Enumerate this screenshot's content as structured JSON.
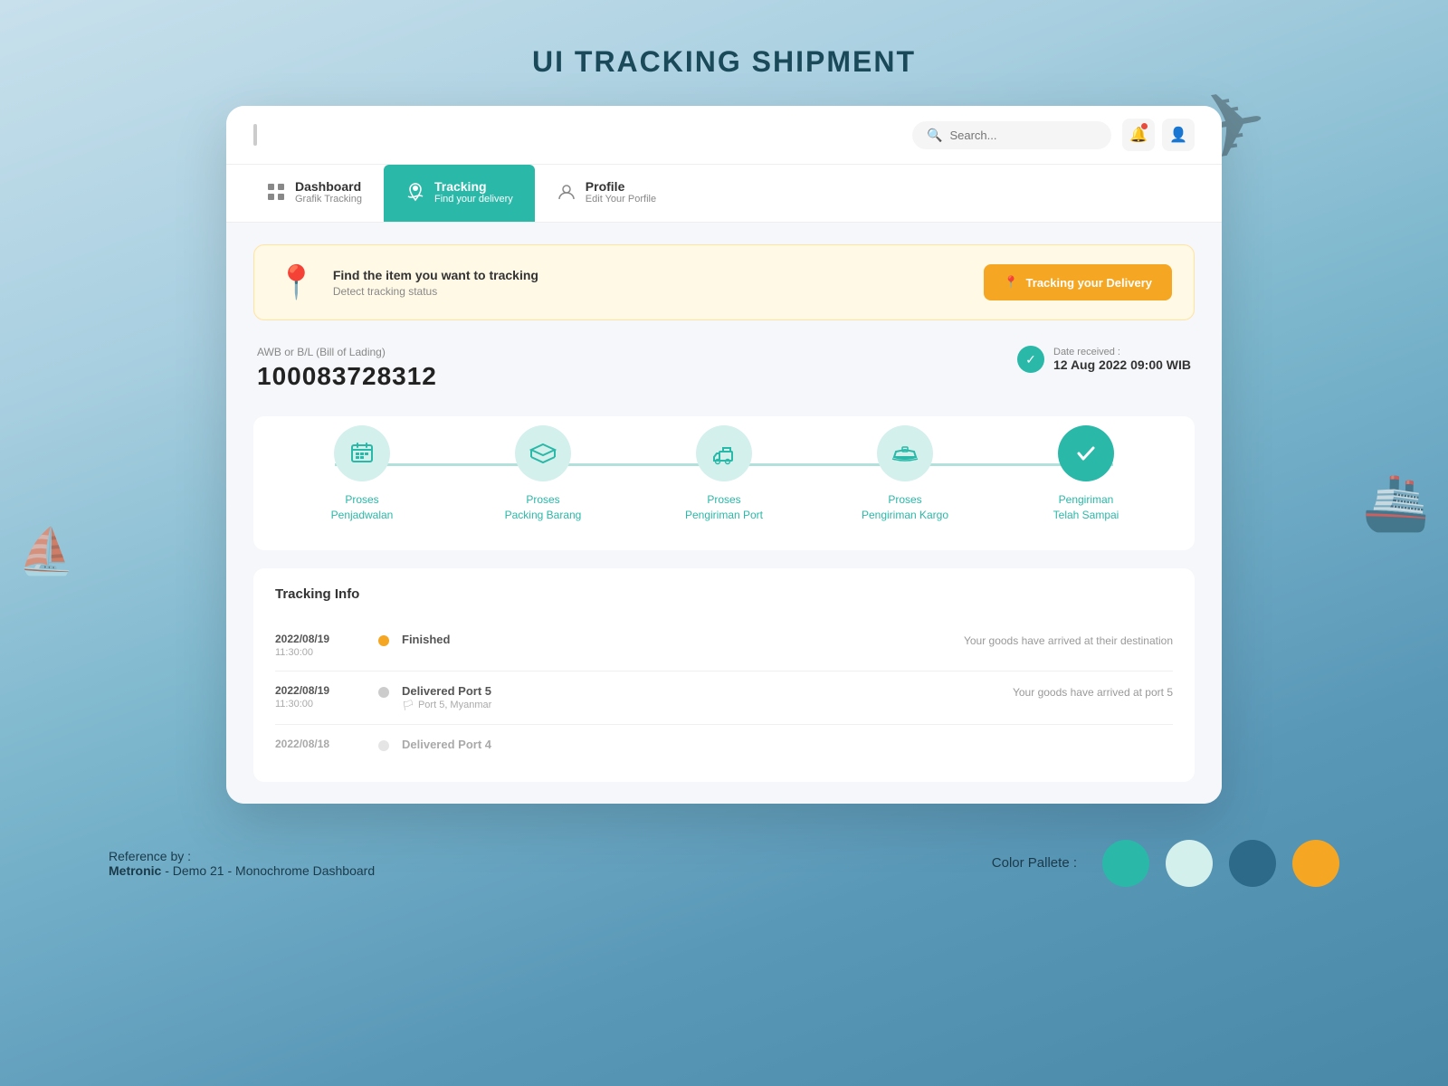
{
  "page": {
    "title": "UI TRACKING SHIPMENT"
  },
  "header": {
    "search_placeholder": "Search...",
    "toggle_label": "menu"
  },
  "nav": {
    "tabs": [
      {
        "id": "dashboard",
        "title": "Dashboard",
        "subtitle": "Grafik Tracking",
        "active": false,
        "icon": "grid-icon"
      },
      {
        "id": "tracking",
        "title": "Tracking",
        "subtitle": "Find your delivery",
        "active": true,
        "icon": "tracking-icon"
      },
      {
        "id": "profile",
        "title": "Profile",
        "subtitle": "Edit Your Porfile",
        "active": false,
        "icon": "user-icon"
      }
    ]
  },
  "banner": {
    "icon": "📍",
    "title": "Find the item you want to tracking",
    "subtitle": "Detect tracking status",
    "button_label": "Tracking your Delivery",
    "button_icon": "📍"
  },
  "awb": {
    "label": "AWB or B/L (Bill of Lading)",
    "number": "100083728312",
    "date_label": "Date received :",
    "date_value": "12 Aug 2022 09:00 WIB"
  },
  "steps": [
    {
      "icon": "📅",
      "label": "Proses\nPenjadwalan",
      "active": false
    },
    {
      "icon": "📦",
      "label": "Proses\nPacking Barang",
      "active": false
    },
    {
      "icon": "🛒",
      "label": "Proses\nPengiriman Port",
      "active": false
    },
    {
      "icon": "🚢",
      "label": "Proses\nPengiriman Kargo",
      "active": false
    },
    {
      "icon": "✓",
      "label": "Pengiriman\nTelah Sampai",
      "active": true
    }
  ],
  "tracking_info": {
    "title": "Tracking Info",
    "items": [
      {
        "date": "2022/08/19",
        "time": "11:30:00",
        "dot_color": "yellow",
        "status": "Finished",
        "sub": "",
        "desc": "Your goods have arrived at their destination"
      },
      {
        "date": "2022/08/19",
        "time": "11:30:00",
        "dot_color": "gray",
        "status": "Delivered Port 5",
        "sub": "🏳 Port 5, Myanmar",
        "desc": "Your goods have arrived at port 5"
      },
      {
        "date": "2022/08/18",
        "time": "",
        "dot_color": "gray",
        "status": "Delivered Port 4",
        "sub": "",
        "desc": ""
      }
    ]
  },
  "footer": {
    "ref_label": "Reference by :",
    "ref_bold": "Metronic",
    "ref_rest": " - Demo 21 - Monochrome Dashboard",
    "palette_label": "Color Pallete :",
    "colors": [
      "#2ab8a8",
      "#d4f0ec",
      "#2d6a8a",
      "#f5a623"
    ]
  },
  "icons": {
    "search": "🔍",
    "bell": "🔔",
    "user": "👤",
    "grid": "⊞",
    "ship": "🚢",
    "plane": "✈"
  }
}
